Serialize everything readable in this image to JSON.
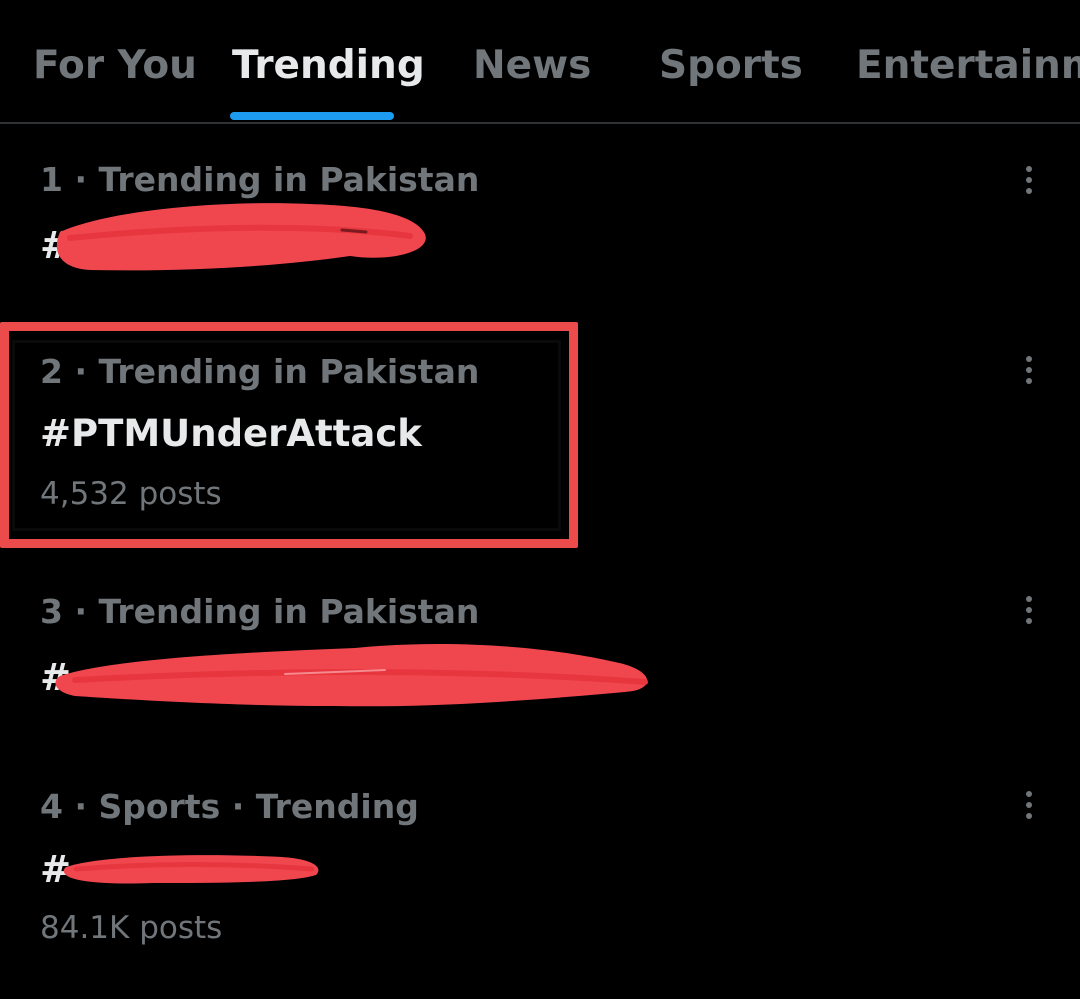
{
  "tabs": [
    {
      "label": "For You",
      "active": false
    },
    {
      "label": "Trending",
      "active": true
    },
    {
      "label": "News",
      "active": false
    },
    {
      "label": "Sports",
      "active": false
    },
    {
      "label": "Entertainme",
      "active": false
    }
  ],
  "trends": [
    {
      "meta": "1 · Trending in Pakistan",
      "hashtag": "#",
      "posts": "",
      "redacted": true
    },
    {
      "meta": "2 · Trending in Pakistan",
      "hashtag": "#PTMUnderAttack",
      "posts": "4,532 posts",
      "redacted": false,
      "highlighted": true
    },
    {
      "meta": "3 · Trending in Pakistan",
      "hashtag": "#",
      "posts": "",
      "redacted": true
    },
    {
      "meta": "4 · Sports · Trending",
      "hashtag": "#",
      "posts": "84.1K posts",
      "redacted": true
    }
  ],
  "icons": {
    "more": "more-vertical-icon"
  },
  "colors": {
    "background": "#000000",
    "primary_text": "#e7e9ea",
    "secondary_text": "#71767b",
    "accent": "#1d9bf0",
    "highlight": "#ec4b4b",
    "redaction": "#f0474f"
  }
}
